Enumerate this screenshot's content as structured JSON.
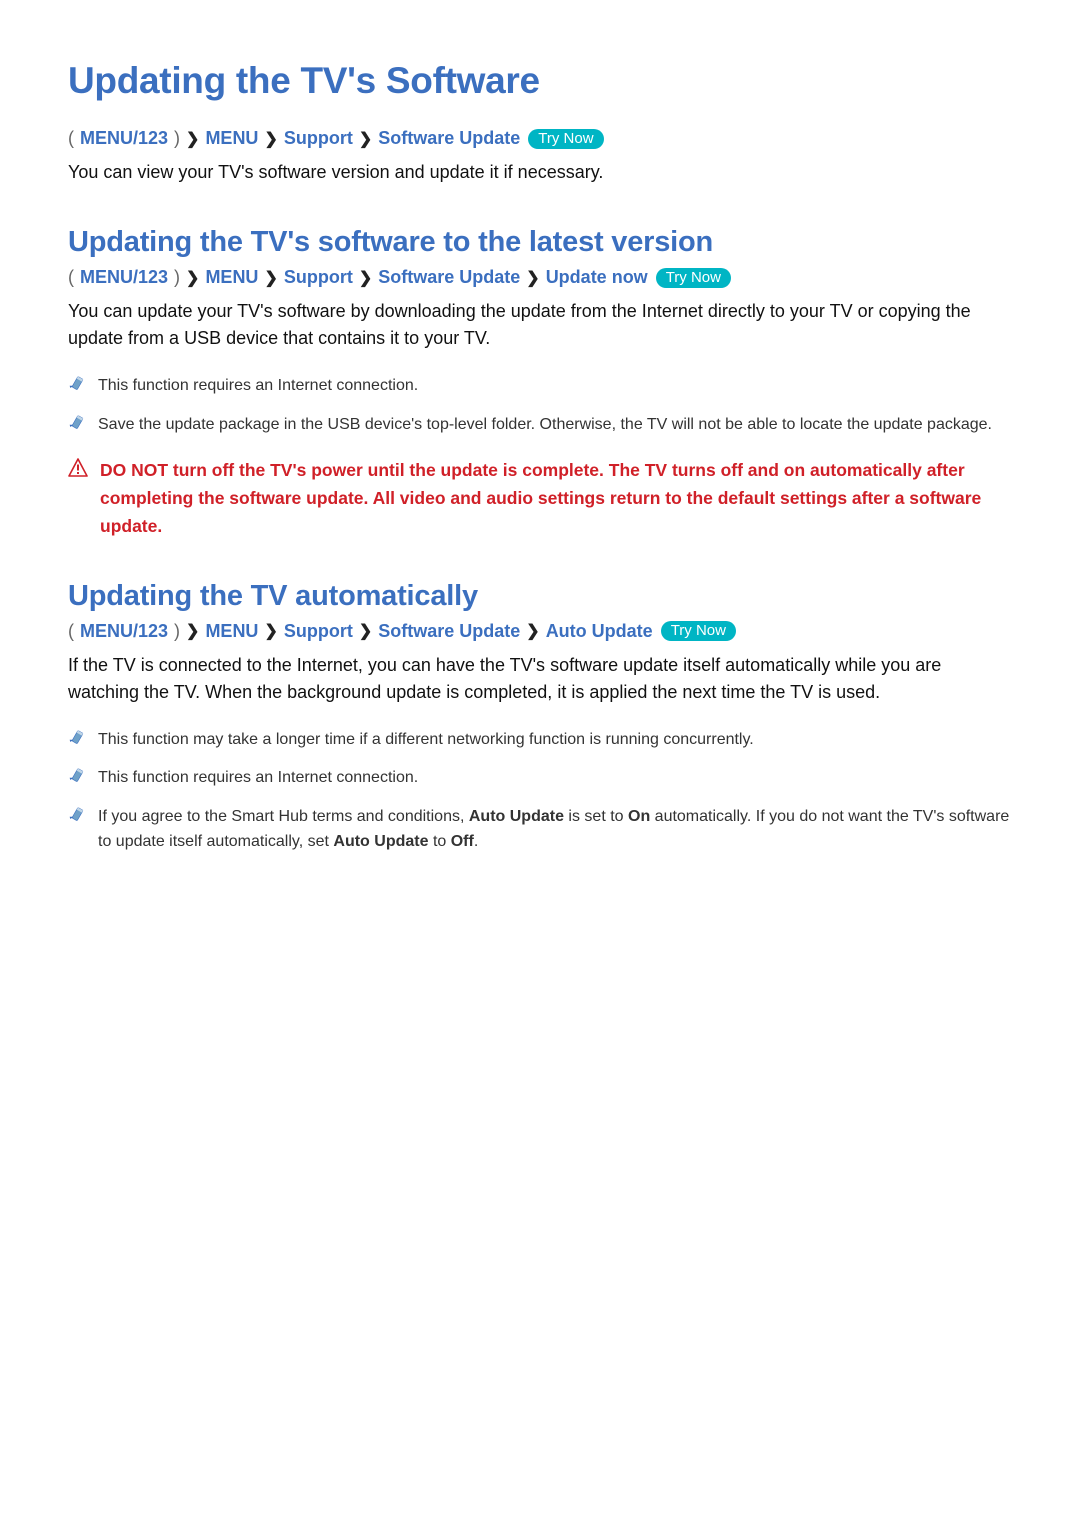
{
  "page": {
    "title": "Updating the TV's Software",
    "breadcrumb1": {
      "a": "MENU/123",
      "b": "MENU",
      "c": "Support",
      "d": "Software Update",
      "try": "Try Now"
    },
    "intro": "You can view your TV's software version and update it if necessary."
  },
  "section1": {
    "title": "Updating the TV's software to the latest version",
    "breadcrumb": {
      "a": "MENU/123",
      "b": "MENU",
      "c": "Support",
      "d": "Software Update",
      "e": "Update now",
      "try": "Try Now"
    },
    "body": "You can update your TV's software by downloading the update from the Internet directly to your TV or copying the update from a USB device that contains it to your TV.",
    "notes": [
      "This function requires an Internet connection.",
      "Save the update package in the USB device's top-level folder. Otherwise, the TV will not be able to locate the update package."
    ],
    "warning": "DO NOT turn off the TV's power until the update is complete. The TV turns off and on automatically after completing the software update. All video and audio settings return to the default settings after a software update."
  },
  "section2": {
    "title": "Updating the TV automatically",
    "breadcrumb": {
      "a": "MENU/123",
      "b": "MENU",
      "c": "Support",
      "d": "Software Update",
      "e": "Auto Update",
      "try": "Try Now"
    },
    "body": "If the TV is connected to the Internet, you can have the TV's software update itself automatically while you are watching the TV. When the background update is completed, it is applied the next time the TV is used.",
    "notes": [
      "This function may take a longer time if a different networking function is running concurrently.",
      "This function requires an Internet connection."
    ],
    "note3": {
      "pre": "If you agree to the Smart Hub terms and conditions, ",
      "b1": "Auto Update",
      "mid1": " is set to ",
      "b2": "On",
      "mid2": " automatically. If you do not want the TV's software to update itself automatically, set ",
      "b3": "Auto Update",
      "mid3": " to ",
      "b4": "Off",
      "post": "."
    }
  }
}
